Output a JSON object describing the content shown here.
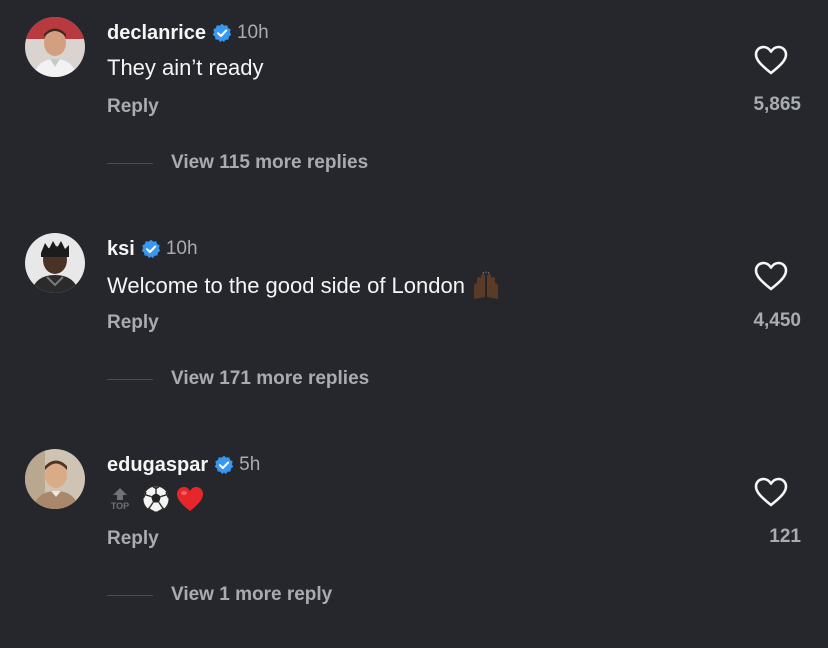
{
  "comments": [
    {
      "username": "declanrice",
      "verified": true,
      "time": "10h",
      "text": "They ain’t ready",
      "reply_label": "Reply",
      "likes": "5,865",
      "view_more": "View 115 more replies"
    },
    {
      "username": "ksi",
      "verified": true,
      "time": "10h",
      "text": "Welcome to the good side of London",
      "emoji": "raising-hands-icon",
      "reply_label": "Reply",
      "likes": "4,450",
      "view_more": "View 171 more replies"
    },
    {
      "username": "edugaspar",
      "verified": true,
      "time": "5h",
      "badge": "TOP",
      "emojis": [
        "soccer-ball-icon",
        "red-heart-icon"
      ],
      "reply_label": "Reply",
      "likes": "121",
      "view_more": "View 1 more reply"
    }
  ],
  "colors": {
    "background": "#25272c",
    "primary_text": "#f5f5f5",
    "secondary_text": "#a8abb2",
    "verified_blue": "#3897f0"
  }
}
